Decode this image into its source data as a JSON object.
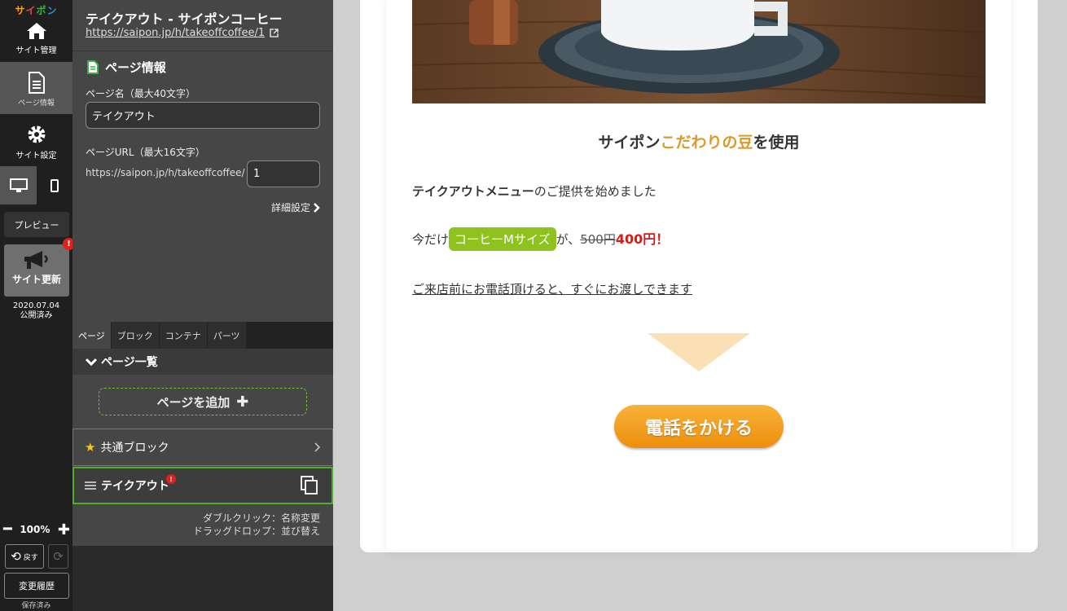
{
  "rail": {
    "logo": [
      "サ",
      "イ",
      "ポ",
      "ン"
    ],
    "site_manage": "サイト管理",
    "page_info": "ページ情報",
    "site_settings": "サイト設定",
    "preview": "プレビュー",
    "update": "サイト更新",
    "date": "2020.07.04",
    "published": "公開済み",
    "zoom": "100%",
    "undo": "戻す",
    "history": "変更履歴",
    "saved": "保存済み"
  },
  "panel": {
    "title": "テイクアウト - サイポンコーヒー",
    "link": "https://saipon.jp/h/takeoffcoffee/1",
    "section": "ページ情報",
    "name_label": "ページ名（最大40文字）",
    "name_value": "テイクアウト",
    "url_label": "ページURL（最大16文字）",
    "url_prefix": "https://saipon.jp/h/takeoffcoffee/",
    "url_value": "1",
    "detail": "詳細設定",
    "tabs": [
      "ページ",
      "ブロック",
      "コンテナ",
      "パーツ"
    ],
    "list_title": "ページ一覧",
    "add_page": "ページを追加",
    "shared_block": "共通ブロック",
    "current_page": "テイクアウト",
    "hint1": "ダブルクリック：名称変更",
    "hint2": "ドラッグドロップ：並び替え"
  },
  "preview": {
    "heading_pre": "サイポン",
    "heading_hl": "こだわりの豆",
    "heading_post": "を使用",
    "menu_bold": "テイクアウトメニュー",
    "menu_rest": "のご提供を始めました",
    "promo_pre": "今だけ",
    "promo_coupon": "コーヒーMサイズ",
    "promo_mid": "が、",
    "promo_old": "500円",
    "promo_new": "400円！",
    "notice": "ご来店前にお電話頂けると、すぐにお渡しできます",
    "call_button": "電話をかける"
  },
  "colors": {
    "accent_green": "#8dc21f",
    "highlight_orange": "#d99a2b",
    "price_red": "#d61a1a",
    "button_orange": "#ec8f0c"
  }
}
